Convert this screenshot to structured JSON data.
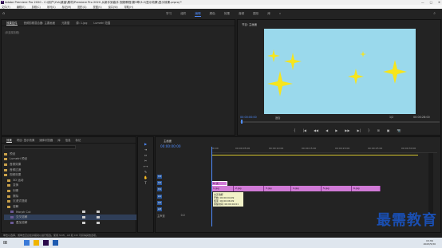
{
  "window": {
    "title": "Adobe Premiere Pro 2020 - C:\\用户\\Ysh\\桌面\\素材\\Premiere Pro 2020 从新手到高手 视频教程\\第3章\\3.2\\显示效果\\显示效果.prproj *",
    "app_badge": "Pr",
    "controls": [
      "—",
      "□",
      "✕"
    ]
  },
  "menu": [
    "文件(F)",
    "编辑(E)",
    "剪辑(C)",
    "序列(S)",
    "标记(M)",
    "图形(G)",
    "视图(V)",
    "窗口(W)",
    "帮助(H)"
  ],
  "workspaces": {
    "tabs": [
      "学习",
      "组件",
      "编辑",
      "颜色",
      "效果",
      "音频",
      "图形",
      "库"
    ],
    "active": "编辑",
    "more": "»"
  },
  "source_panel": {
    "tabs": [
      "效果控件",
      "音频剪辑混合器: 主要画面",
      "元数据",
      "源: 1.jpg",
      "Lumetri 范围"
    ],
    "active": "效果控件",
    "message": "(未选择剪辑)"
  },
  "program_panel": {
    "title": "节目: 主画面",
    "timecode": "00:00:00:00",
    "fit": "适合",
    "quality": "1/2",
    "duration": "00:00:28:00",
    "controls": [
      "{",
      "|◀",
      "◀◀",
      "◀",
      "▶",
      "▶▶",
      "▶|",
      "}",
      "⊞",
      "▣",
      "📷"
    ]
  },
  "project_panel": {
    "tabs": [
      "效果",
      "项目: 显示效果",
      "媒体浏览器",
      "库",
      "信息",
      "标记"
    ],
    "active": "效果",
    "items": [
      {
        "label": "预设",
        "type": "folder"
      },
      {
        "label": "Lumetri 预设",
        "type": "folder"
      },
      {
        "label": "音频效果",
        "type": "folder"
      },
      {
        "label": "音频过渡",
        "type": "folder"
      },
      {
        "label": "视频效果",
        "type": "folder"
      },
      {
        "label": "3D 运动",
        "type": "folder"
      },
      {
        "label": "变换",
        "type": "folder"
      },
      {
        "label": "划像",
        "type": "folder"
      },
      {
        "label": "擦除",
        "type": "folder"
      },
      {
        "label": "沉浸式视频",
        "type": "folder"
      },
      {
        "label": "溶解",
        "type": "folder"
      },
      {
        "label": "内滑",
        "type": "folder"
      },
      {
        "label": "Morph Cut",
        "type": "fx"
      },
      {
        "label": "交叉溶解",
        "type": "fx",
        "selected": true
      },
      {
        "label": "叠加溶解",
        "type": "fx"
      }
    ]
  },
  "tools": [
    "▶",
    "⇥",
    "⇔",
    "✂",
    "⟷",
    "✎",
    "✋",
    "T"
  ],
  "timeline": {
    "title": "主画面",
    "timecode": "00:00:00:00",
    "ruler": [
      "00:00",
      "00:00:05:00",
      "00:00:10:00",
      "00:00:15:00",
      "00:00:20:00",
      "00:00:25:00",
      "00:00:30:00"
    ],
    "tracks": [
      "V3",
      "V2",
      "V1",
      "A1",
      "A2",
      "A3",
      "主声道"
    ],
    "master_value": "0.0",
    "fx_badge": "fx 交",
    "clips": [
      "1.jpg",
      "2.jpg",
      "3.jpg",
      "4.jpg",
      "5.jpg",
      "6.jpg"
    ],
    "tooltip": [
      "交叉溶解",
      "开始: 00:00:04:09",
      "结束: 00:00:06:09",
      "持续时间: 00:00:02:01"
    ]
  },
  "watermark": "最需教育",
  "status_text": "单击以选择，或单击空白处并拖动以进行框选。使用 Shift、Alt 和 Ctrl 可获得其他选项。",
  "taskbar": {
    "time": "15:36",
    "date": "2023/5/30"
  }
}
